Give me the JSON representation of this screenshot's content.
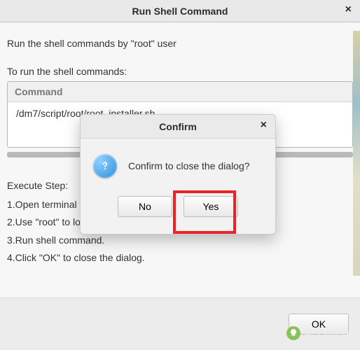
{
  "main": {
    "title": "Run Shell Command",
    "close": "×",
    "description": "Run the shell commands by \"root\" user",
    "label": "To run the shell commands:",
    "command_header": "Command",
    "command_value": "/dm7/script/root/root_installer.sh",
    "steps_header": "Execute Step:",
    "steps": {
      "s1": "1.Open terminal tool.",
      "s2": "2.Use \"root\" to log in.",
      "s3": "3.Run shell command.",
      "s4": "4.Click \"OK\" to close the dialog."
    },
    "ok": "OK"
  },
  "confirm": {
    "title": "Confirm",
    "close": "×",
    "message": "Confirm to close the dialog?",
    "no": "No",
    "yes": "Yes",
    "icon": "question-icon"
  },
  "watermark": "鹏大师运维"
}
